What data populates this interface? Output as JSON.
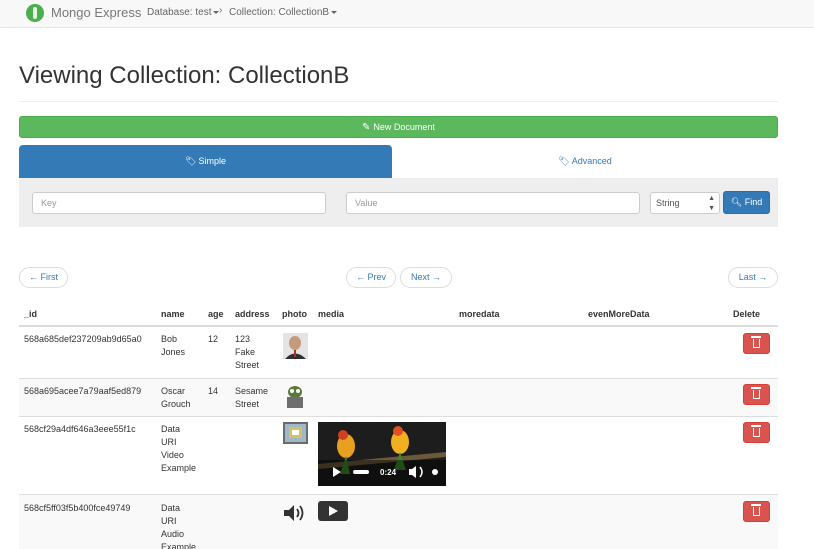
{
  "navbar": {
    "brand": "Mongo Express",
    "database_label": "Database: test",
    "collection_label": "Collection: CollectionB"
  },
  "page_title": "Viewing Collection: CollectionB",
  "new_document_label": "New Document",
  "tabs": {
    "simple": "Simple",
    "advanced": "Advanced"
  },
  "search": {
    "key_placeholder": "Key",
    "value_placeholder": "Value",
    "type_value": "String",
    "find_label": "Find"
  },
  "pagination": {
    "first": "← First",
    "prev": "← Prev",
    "next": "Next →",
    "last": "Last →"
  },
  "table": {
    "columns": [
      "_id",
      "name",
      "age",
      "address",
      "photo",
      "media",
      "moredata",
      "evenMoreData",
      "Delete"
    ],
    "rows": [
      {
        "id": "568a685def237209ab9d65a0",
        "name_lines": [
          "Bob",
          "Jones"
        ],
        "age": "12",
        "address_lines": [
          "123",
          "Fake",
          "Street"
        ]
      },
      {
        "id": "568a695acee7a79aaf5ed879",
        "name_lines": [
          "Oscar",
          "Grouch"
        ],
        "age": "14",
        "address_lines": [
          "Sesame",
          "Street"
        ]
      },
      {
        "id": "568cf29a4df646a3eee55f1c",
        "name_lines": [
          "Data",
          "URI",
          "Video",
          "Example"
        ],
        "age": "",
        "address_lines": []
      },
      {
        "id": "568cf5ff03f5b400fce49749",
        "name_lines": [
          "Data",
          "URI",
          "Audio",
          "Example"
        ],
        "age": "",
        "address_lines": []
      }
    ]
  },
  "video_player": {
    "time": "0:24"
  },
  "colors": {
    "primary": "#337ab7",
    "success": "#5cb85c",
    "danger": "#d9534f"
  }
}
